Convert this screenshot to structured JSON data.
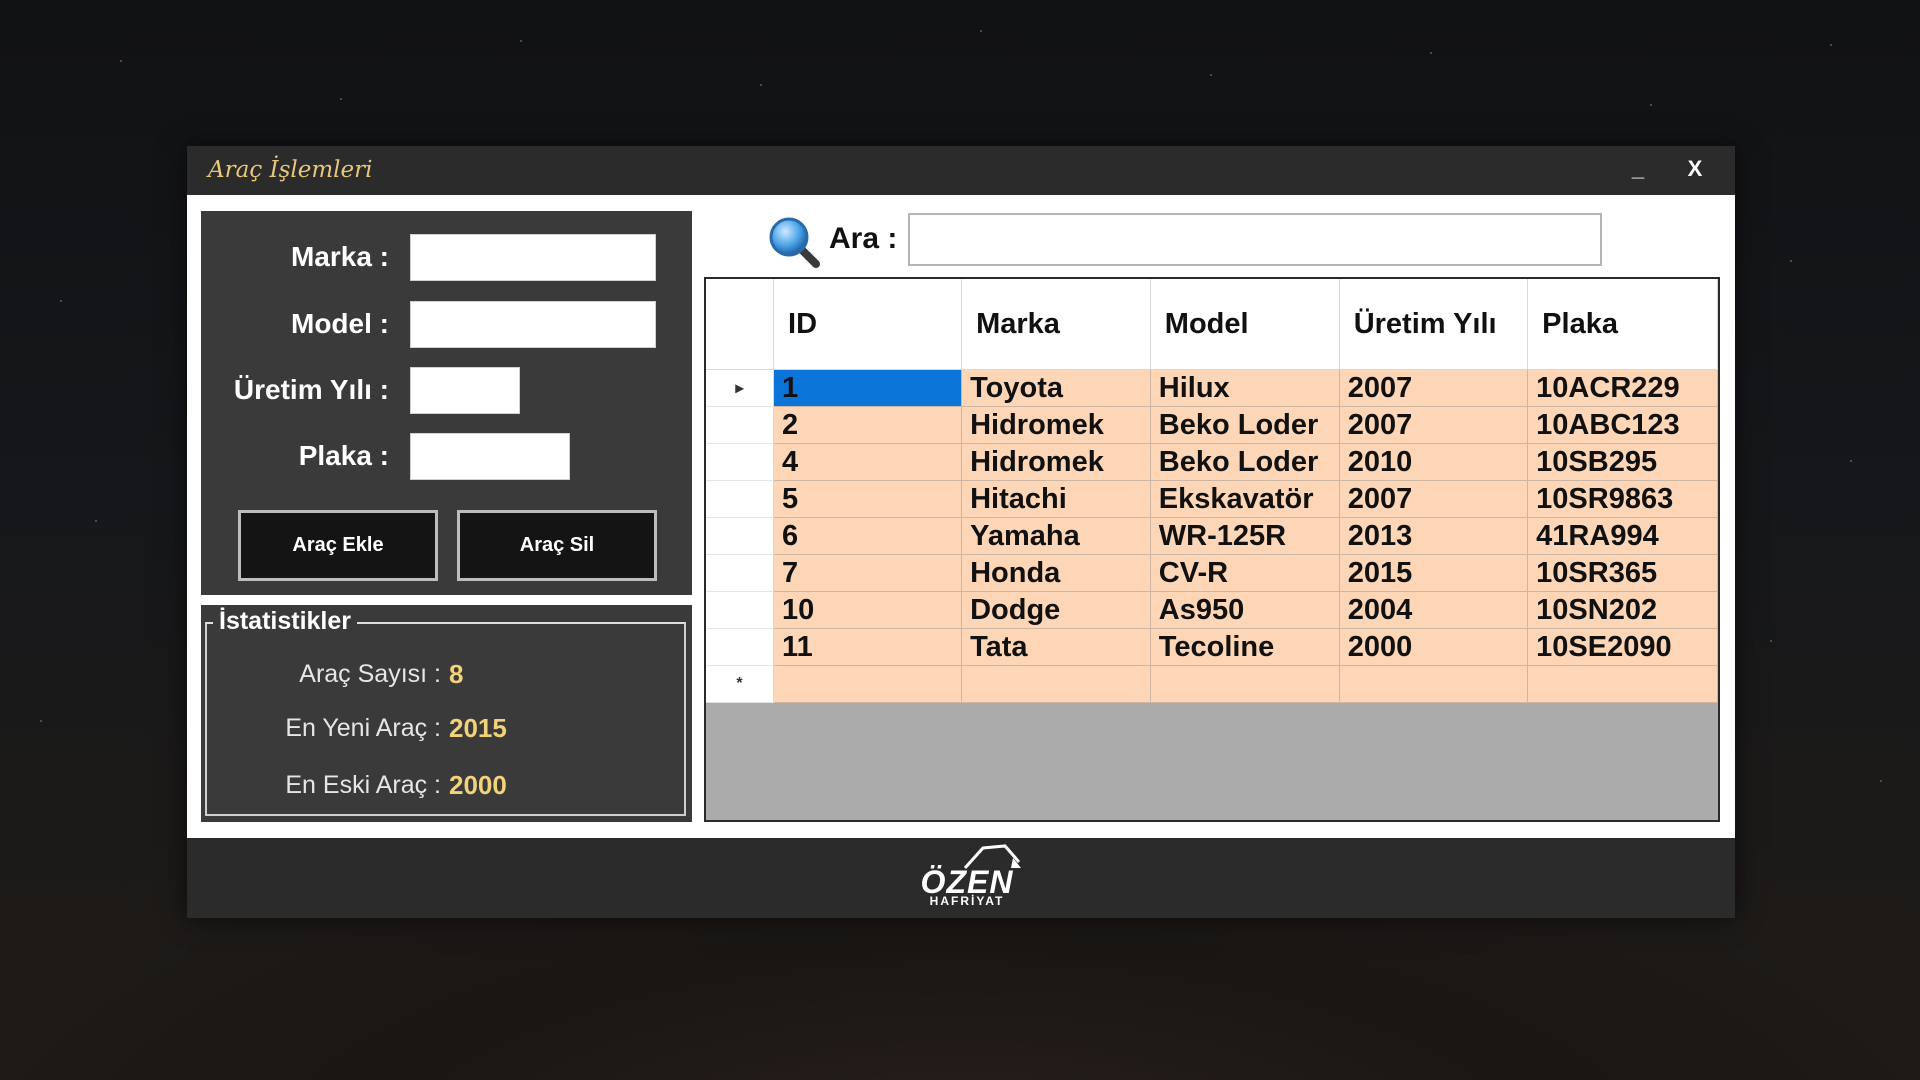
{
  "window": {
    "title": "Araç İşlemleri",
    "minimize_label": "_",
    "close_label": "X"
  },
  "form": {
    "marka_label": "Marka :",
    "model_label": "Model :",
    "uretim_yili_label": "Üretim Yılı :",
    "plaka_label": "Plaka :",
    "marka_value": "",
    "model_value": "",
    "uretim_yili_value": "",
    "plaka_value": "",
    "add_button": "Araç Ekle",
    "delete_button": "Araç Sil"
  },
  "stats": {
    "legend": "İstatistikler",
    "count_label": "Araç Sayısı :",
    "count_value": "8",
    "newest_label": "En Yeni Araç :",
    "newest_value": "2015",
    "oldest_label": "En Eski Araç :",
    "oldest_value": "2000"
  },
  "search": {
    "label": "Ara :",
    "value": "",
    "icon": "magnifier-icon"
  },
  "grid": {
    "columns": [
      "ID",
      "Marka",
      "Model",
      "Üretim Yılı",
      "Plaka"
    ],
    "current_row_marker": "▸",
    "new_row_marker": "*",
    "rows": [
      [
        "1",
        "Toyota",
        "Hilux",
        "2007",
        "10ACR229"
      ],
      [
        "2",
        "Hidromek",
        "Beko Loder",
        "2007",
        "10ABC123"
      ],
      [
        "4",
        "Hidromek",
        "Beko Loder",
        "2010",
        "10SB295"
      ],
      [
        "5",
        "Hitachi",
        "Ekskavatör",
        "2007",
        "10SR9863"
      ],
      [
        "6",
        "Yamaha",
        "WR-125R",
        "2013",
        "41RA994"
      ],
      [
        "7",
        "Honda",
        "CV-R",
        "2015",
        "10SR365"
      ],
      [
        "10",
        "Dodge",
        "As950",
        "2004",
        "10SN202"
      ],
      [
        "11",
        "Tata",
        "Tecoline",
        "2000",
        "10SE2090"
      ]
    ]
  },
  "footer": {
    "logo_text": "ÖZEN",
    "logo_subtext": "HAFRİYAT"
  },
  "colors": {
    "row_bg": "#fcd6b6",
    "selected_cell": "#0a74d9",
    "stat_value": "#f2d27a",
    "title_text": "#e8c77a"
  }
}
